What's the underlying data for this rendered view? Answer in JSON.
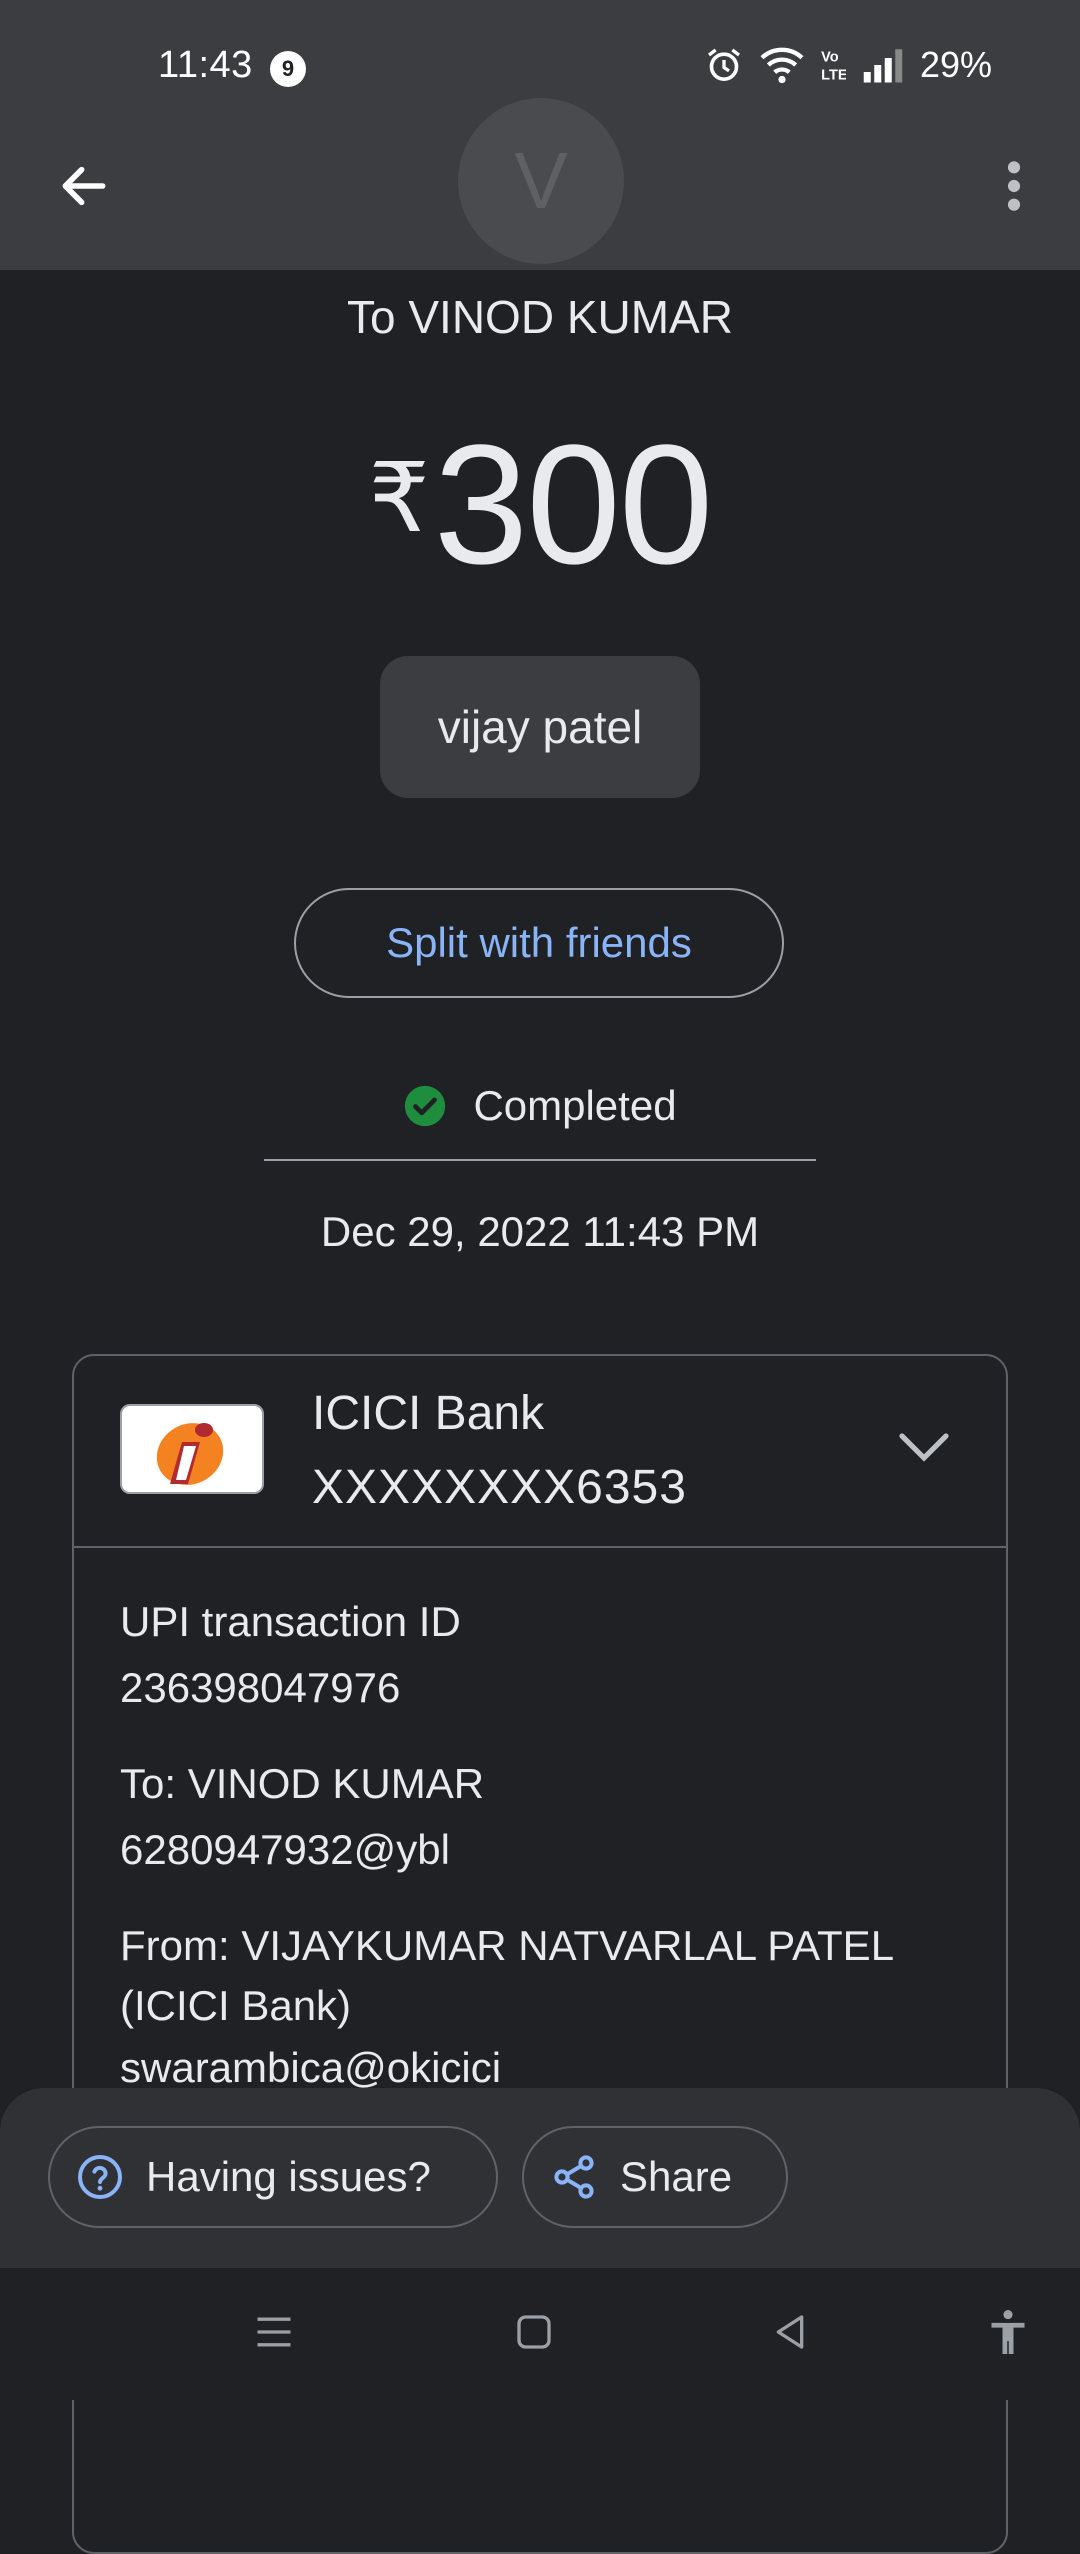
{
  "status_bar": {
    "time": "11:43",
    "notification_count": "9",
    "battery": "29%"
  },
  "header": {
    "avatar_letter": "V"
  },
  "payment": {
    "recipient_title": "To VINOD KUMAR",
    "currency_symbol": "₹",
    "amount": "300",
    "note": "vijay patel",
    "split_label": "Split with friends",
    "status": "Completed",
    "datetime": "Dec 29, 2022 11:43 PM"
  },
  "bank": {
    "name": "ICICI Bank",
    "account": "XXXXXXXX6353"
  },
  "details": {
    "upi_id_label": "UPI transaction ID",
    "upi_id_value": "236398047976",
    "to_label": "To: VINOD KUMAR",
    "to_value": "6280947932@ybl",
    "from_label_line1": "From: VIJAYKUMAR NATVARLAL PATEL",
    "from_label_line2": "(ICICI Bank)",
    "from_value": "swarambica@okicici"
  },
  "actions": {
    "issues_label": "Having issues?",
    "share_label": "Share"
  },
  "colors": {
    "background": "#202124",
    "accent_blue": "#8ab4f8",
    "success_green": "#1e8e3e",
    "bank_orange": "#f58220",
    "bank_red": "#b02a30"
  },
  "icons": [
    "back-arrow-icon",
    "more-vert-icon",
    "check-circle-icon",
    "chevron-down-icon",
    "help-icon",
    "share-icon",
    "menu-icon",
    "home-square-icon",
    "back-triangle-icon",
    "accessibility-icon",
    "alarm-icon",
    "wifi-icon",
    "volte-icon",
    "signal-icon"
  ]
}
